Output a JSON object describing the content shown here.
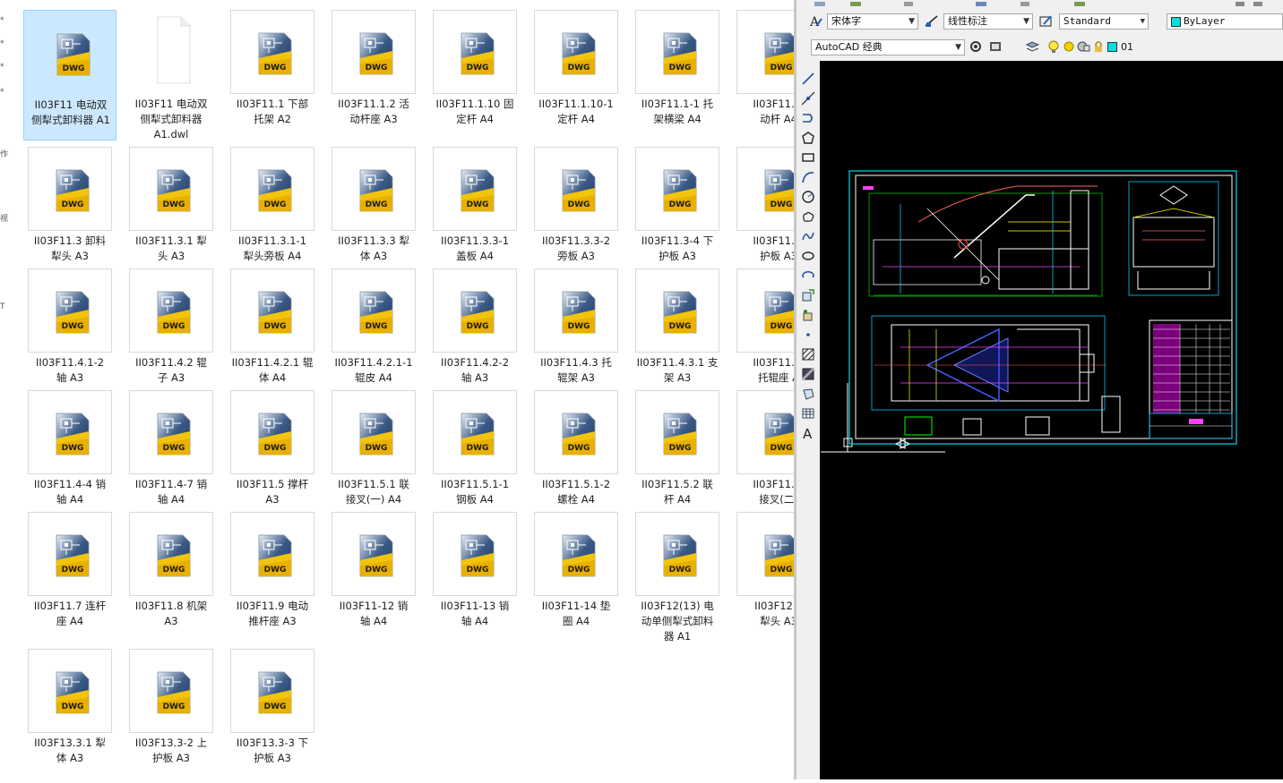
{
  "explorer": {
    "nav_marks": [
      "*",
      "*",
      "*",
      "*",
      "作",
      "视",
      "T"
    ],
    "files": [
      {
        "name": "II03F11 电动双\n侧犁式卸料器 A1",
        "type": "DWG",
        "selected": true
      },
      {
        "name": "II03F11 电动双\n侧犁式卸料器\nA1.dwl",
        "type": "blank"
      },
      {
        "name": "II03F11.1 下部\n托架 A2",
        "type": "DWG"
      },
      {
        "name": "II03F11.1.2 活\n动杆座 A3",
        "type": "DWG"
      },
      {
        "name": "II03F11.1.10 固\n定杆 A4",
        "type": "DWG"
      },
      {
        "name": "II03F11.1.10-1\n定杆 A4",
        "type": "DWG"
      },
      {
        "name": "II03F11.1-1 托\n架横梁 A4",
        "type": "DWG"
      },
      {
        "name": "II03F11.1.\n动杆 A4",
        "type": "DWG"
      },
      {
        "name": "II03F11.3 卸料\n犁头 A3",
        "type": "DWG"
      },
      {
        "name": "II03F11.3.1 犁\n头 A3",
        "type": "DWG"
      },
      {
        "name": "II03F11.3.1-1\n犁头旁板 A4",
        "type": "DWG"
      },
      {
        "name": "II03F11.3.3 犁\n体 A3",
        "type": "DWG"
      },
      {
        "name": "II03F11.3.3-1\n盖板 A4",
        "type": "DWG"
      },
      {
        "name": "II03F11.3.3-2\n旁板 A3",
        "type": "DWG"
      },
      {
        "name": "II03F11.3-4 下\n护板 A3",
        "type": "DWG"
      },
      {
        "name": "II03F11.3.\n护板 A3",
        "type": "DWG"
      },
      {
        "name": "II03F11.4.1-2\n轴 A3",
        "type": "DWG"
      },
      {
        "name": "II03F11.4.2 辊\n子 A3",
        "type": "DWG"
      },
      {
        "name": "II03F11.4.2.1 辊\n体 A4",
        "type": "DWG"
      },
      {
        "name": "II03F11.4.2.1-1\n辊皮 A4",
        "type": "DWG"
      },
      {
        "name": "II03F11.4.2-2\n轴 A3",
        "type": "DWG"
      },
      {
        "name": "II03F11.4.3 托\n辊架 A3",
        "type": "DWG"
      },
      {
        "name": "II03F11.4.3.1 支\n架 A3",
        "type": "DWG"
      },
      {
        "name": "II03F11.4.\n托辊座 A",
        "type": "DWG"
      },
      {
        "name": "II03F11.4-4 销\n轴 A4",
        "type": "DWG"
      },
      {
        "name": "II03F11.4-7 销\n轴 A4",
        "type": "DWG"
      },
      {
        "name": "II03F11.5 撑杆\nA3",
        "type": "DWG"
      },
      {
        "name": "II03F11.5.1 联\n接叉(一) A4",
        "type": "DWG"
      },
      {
        "name": "II03F11.5.1-1\n钢板 A4",
        "type": "DWG"
      },
      {
        "name": "II03F11.5.1-2\n螺栓 A4",
        "type": "DWG"
      },
      {
        "name": "II03F11.5.2 联\n杆 A4",
        "type": "DWG"
      },
      {
        "name": "II03F11.5.\n接叉(二)",
        "type": "DWG"
      },
      {
        "name": "II03F11.7 连杆\n座 A4",
        "type": "DWG"
      },
      {
        "name": "II03F11.8 机架\nA3",
        "type": "DWG"
      },
      {
        "name": "II03F11.9 电动\n推杆座 A3",
        "type": "DWG"
      },
      {
        "name": "II03F11-12 销\n轴 A4",
        "type": "DWG"
      },
      {
        "name": "II03F11-13 销\n轴 A4",
        "type": "DWG"
      },
      {
        "name": "II03F11-14 垫\n圈 A4",
        "type": "DWG"
      },
      {
        "name": "II03F12(13) 电\n动单侧犁式卸料\n器 A1",
        "type": "DWG"
      },
      {
        "name": "II03F12.3\n犁头 A3",
        "type": "DWG"
      },
      {
        "name": "II03F13.3.1 犁\n体 A3",
        "type": "DWG"
      },
      {
        "name": "II03F13.3-2 上\n护板 A3",
        "type": "DWG"
      },
      {
        "name": "II03F13.3-3 下\n护板 A3",
        "type": "DWG"
      }
    ]
  },
  "autocad": {
    "font_combo": "宋体字",
    "dim_combo": "线性标注",
    "style_combo": "Standard",
    "color_combo": "ByLayer",
    "workspace_combo": "AutoCAD 经典",
    "layer_name": "01",
    "text_tool": "A",
    "accent_color": "#00c8d8",
    "canvas_color": "#000000"
  }
}
